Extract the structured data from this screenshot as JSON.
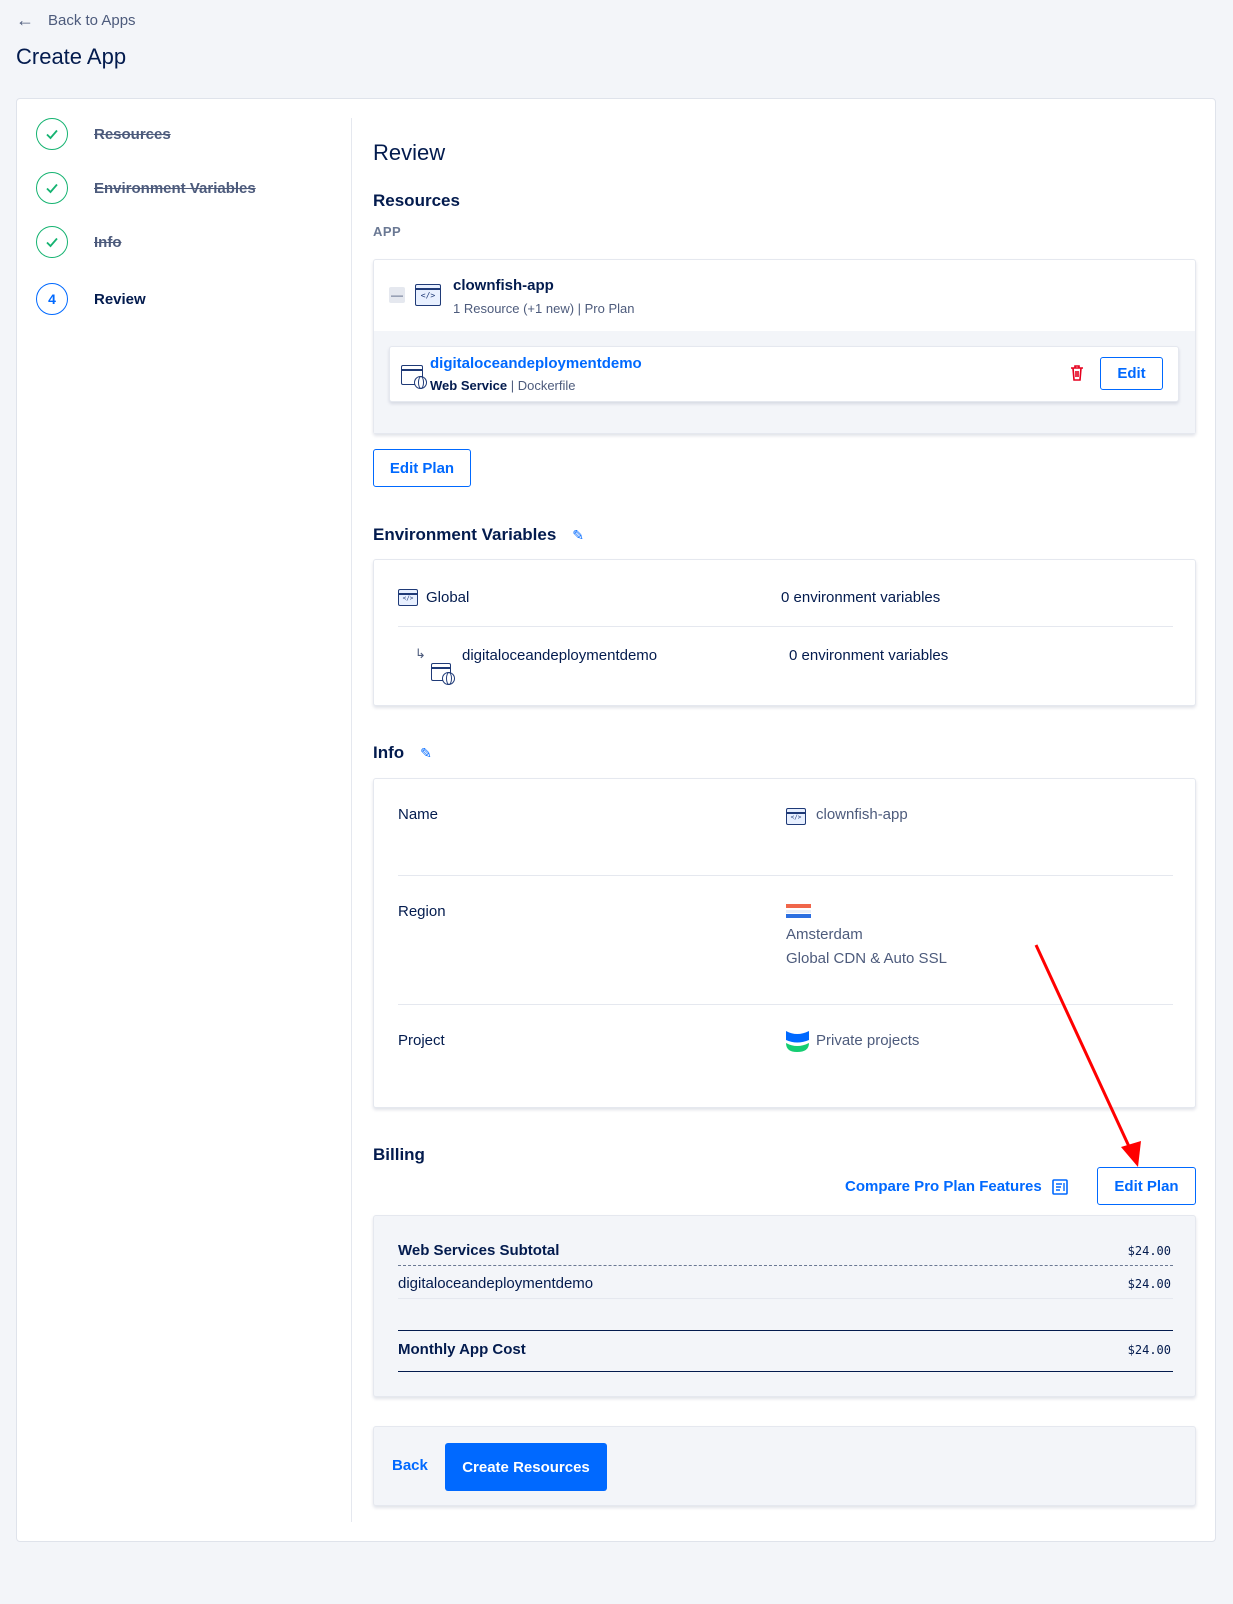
{
  "nav": {
    "back_label": "Back to Apps",
    "page_title": "Create App"
  },
  "steps": [
    {
      "label": "Resources",
      "state": "done"
    },
    {
      "label": "Environment Variables",
      "state": "done"
    },
    {
      "label": "Info",
      "state": "done"
    },
    {
      "number": "4",
      "label": "Review",
      "state": "current"
    }
  ],
  "review": {
    "title": "Review",
    "resources": {
      "heading": "Resources",
      "subheading": "APP",
      "app_name": "clownfish-app",
      "app_meta": "1 Resource (+1 new) | Pro Plan",
      "collapse_symbol": "—",
      "component": {
        "name": "digitaloceandeploymentdemo",
        "type": "Web Service",
        "source": " | Dockerfile",
        "edit_label": "Edit"
      },
      "edit_plan_label": "Edit Plan"
    },
    "env": {
      "heading": "Environment Variables",
      "rows": [
        {
          "name": "Global",
          "count": "0 environment variables"
        },
        {
          "name": "digitaloceandeploymentdemo",
          "count": "0 environment variables"
        }
      ]
    },
    "info": {
      "heading": "Info",
      "name_label": "Name",
      "name_value": "clownfish-app",
      "region_label": "Region",
      "region_city": "Amsterdam",
      "region_note": "Global CDN & Auto SSL",
      "project_label": "Project",
      "project_value": "Private projects"
    },
    "billing": {
      "heading": "Billing",
      "compare_label": "Compare Pro Plan Features",
      "edit_plan_label": "Edit Plan",
      "subtotal_label": "Web Services Subtotal",
      "subtotal_value": "$24.00",
      "item_label": "digitaloceandeploymentdemo",
      "item_value": "$24.00",
      "total_label": "Monthly App Cost",
      "total_value": "$24.00"
    },
    "actions": {
      "back_label": "Back",
      "create_label": "Create Resources"
    }
  },
  "colors": {
    "accent": "#0069ff",
    "success": "#15b371",
    "danger": "#e5001e",
    "annotation": "#ff0000"
  },
  "icons": [
    "back-arrow-icon",
    "check-icon",
    "app-icon",
    "web-service-icon",
    "trash-icon",
    "pencil-icon",
    "netherlands-flag-icon",
    "project-icon",
    "document-icon"
  ]
}
